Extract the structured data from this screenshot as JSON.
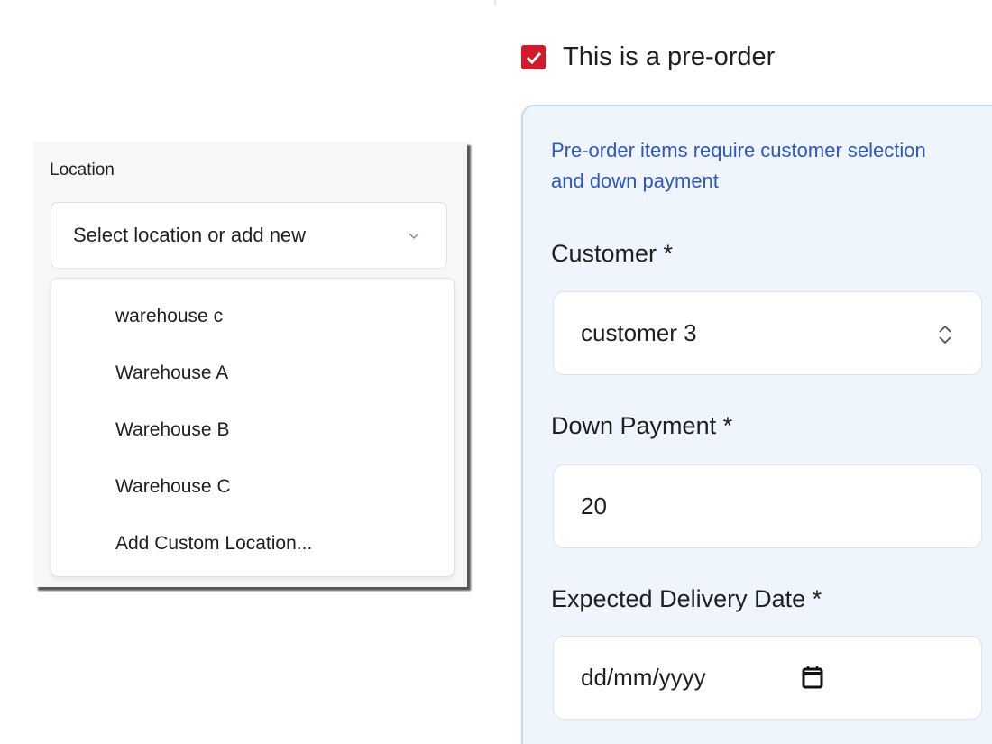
{
  "location_dropdown": {
    "label": "Location",
    "placeholder": "Select location or add new",
    "options": [
      "warehouse c",
      "Warehouse A",
      "Warehouse B",
      "Warehouse C",
      "Add Custom Location..."
    ],
    "icons": {
      "chevron": "chevron-down-icon"
    }
  },
  "preorder_form": {
    "preorder_checkbox_label": "This is a pre-order",
    "preorder_checked": true,
    "note": "Pre-order items require customer selection and down payment",
    "customer_label": "Customer *",
    "customer_value": "customer 3",
    "down_payment_label": "Down Payment *",
    "down_payment_value": "20",
    "delivery_date_label": "Expected Delivery Date *",
    "delivery_date_placeholder": "dd/mm/yyyy",
    "icons": {
      "customer_stepper": "up-down-chevron-icon",
      "date_picker": "calendar-icon"
    }
  },
  "colors": {
    "checkbox": "#d11a2a",
    "info_box_bg": "#eef5fd",
    "info_box_border": "#bfdbf7",
    "note_text": "#2f56c6"
  }
}
